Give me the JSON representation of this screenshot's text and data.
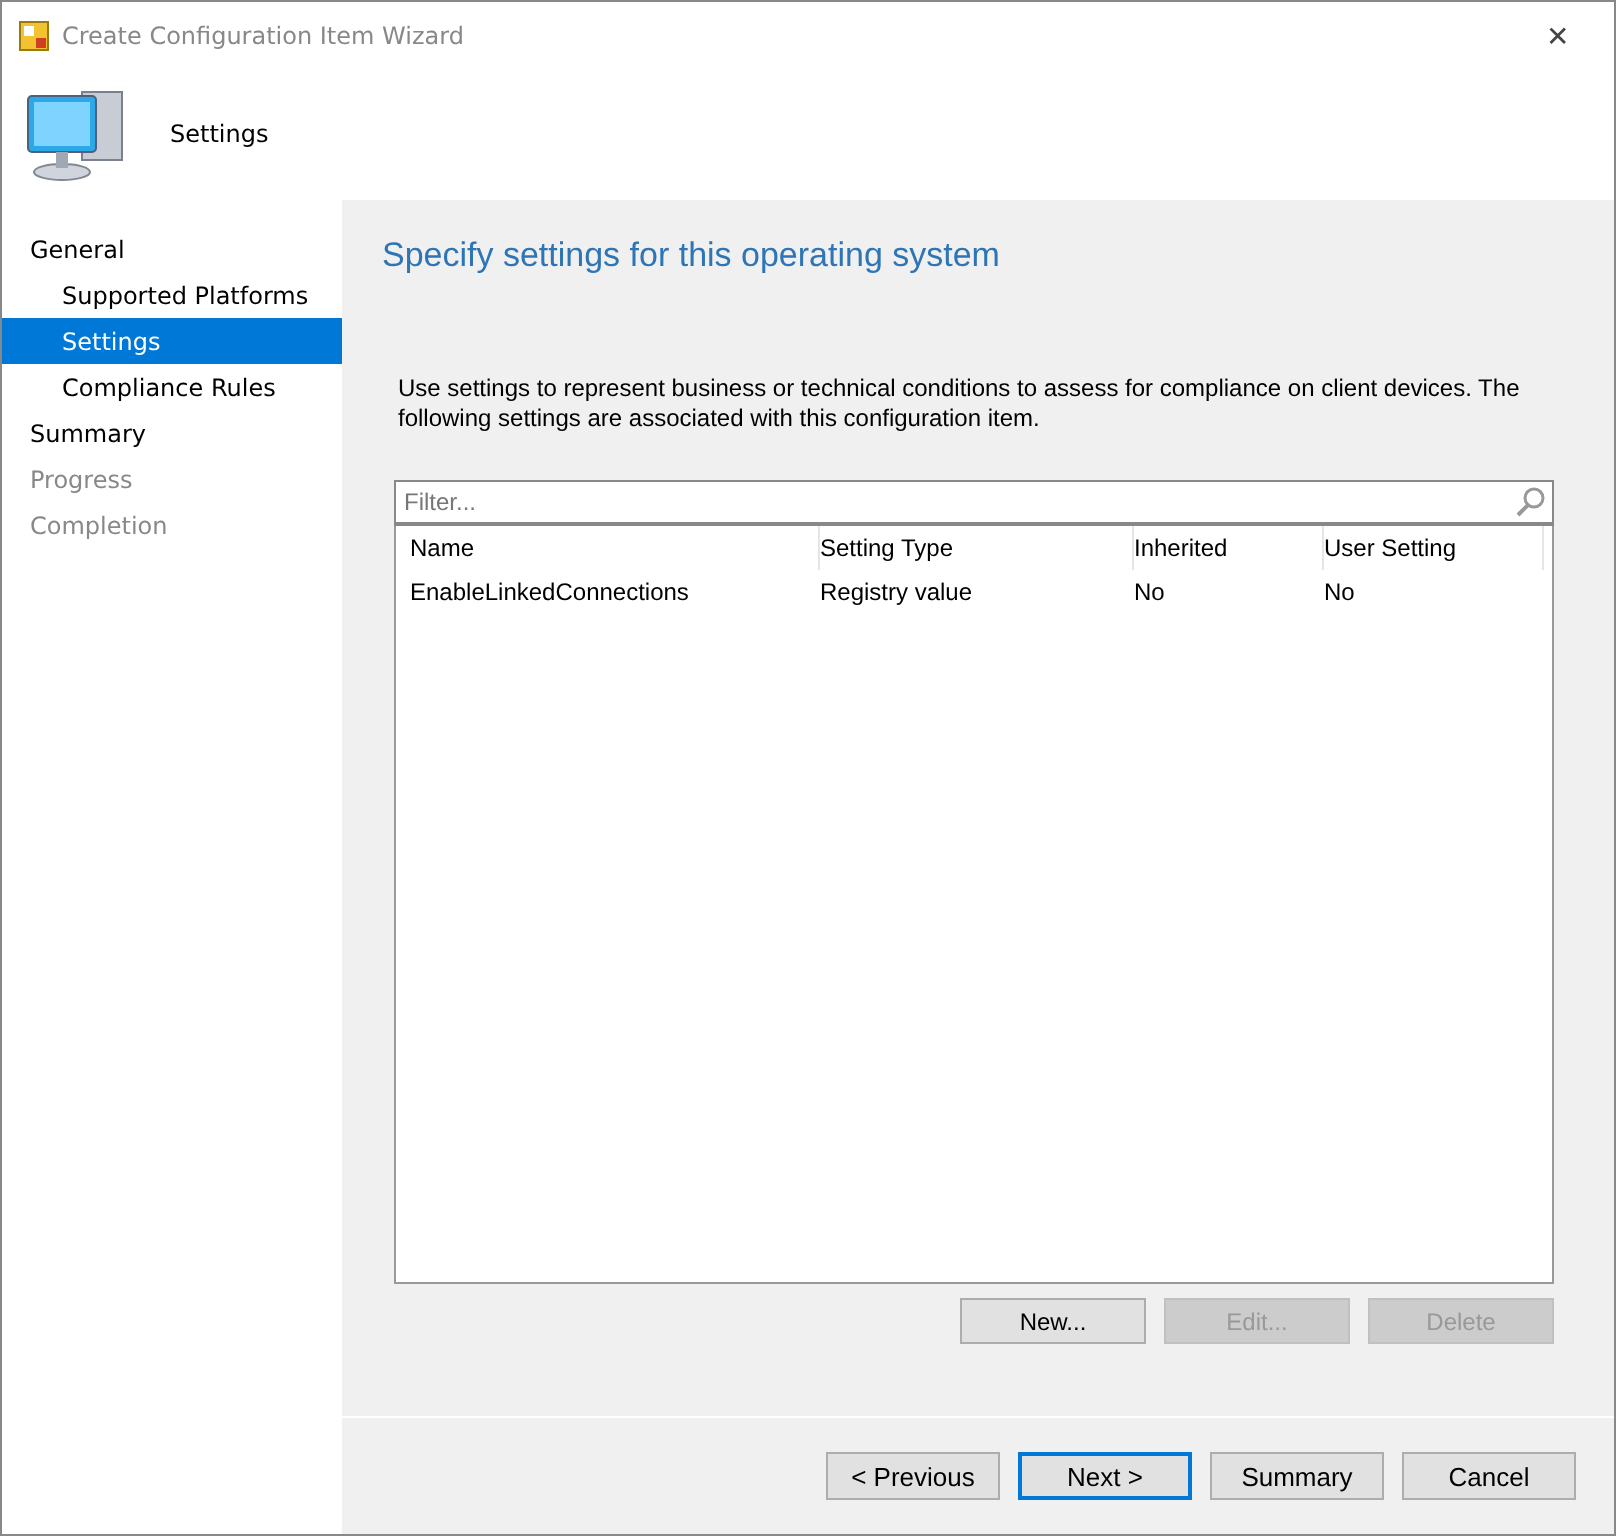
{
  "window": {
    "title": "Create Configuration Item Wizard",
    "close": "✕"
  },
  "header": {
    "title": "Settings"
  },
  "sidebar": {
    "items": [
      {
        "label": "General",
        "selected": false,
        "disabled": false,
        "children": [
          {
            "label": "Supported Platforms",
            "selected": false,
            "disabled": false
          },
          {
            "label": "Settings",
            "selected": true,
            "disabled": false
          },
          {
            "label": "Compliance Rules",
            "selected": false,
            "disabled": false
          }
        ]
      },
      {
        "label": "Summary",
        "selected": false,
        "disabled": false
      },
      {
        "label": "Progress",
        "selected": false,
        "disabled": true
      },
      {
        "label": "Completion",
        "selected": false,
        "disabled": true
      }
    ]
  },
  "page": {
    "heading": "Specify settings for this operating system",
    "description": "Use settings to represent business or technical conditions to assess for compliance on client devices. The following settings are associated with this configuration item."
  },
  "filter": {
    "placeholder": "Filter..."
  },
  "table": {
    "columns": [
      "Name",
      "Setting Type",
      "Inherited",
      "User Setting"
    ],
    "rows": [
      {
        "cells": [
          "EnableLinkedConnections",
          "Registry value",
          "No",
          "No"
        ],
        "selected": false
      }
    ]
  },
  "table_buttons": [
    {
      "label": "New...",
      "disabled": false
    },
    {
      "label": "Edit...",
      "disabled": true
    },
    {
      "label": "Delete",
      "disabled": true
    }
  ],
  "footer_buttons": [
    {
      "label": "< Previous",
      "default": false
    },
    {
      "label": "Next >",
      "default": true
    },
    {
      "label": "Summary",
      "default": false
    },
    {
      "label": "Cancel",
      "default": false
    }
  ]
}
